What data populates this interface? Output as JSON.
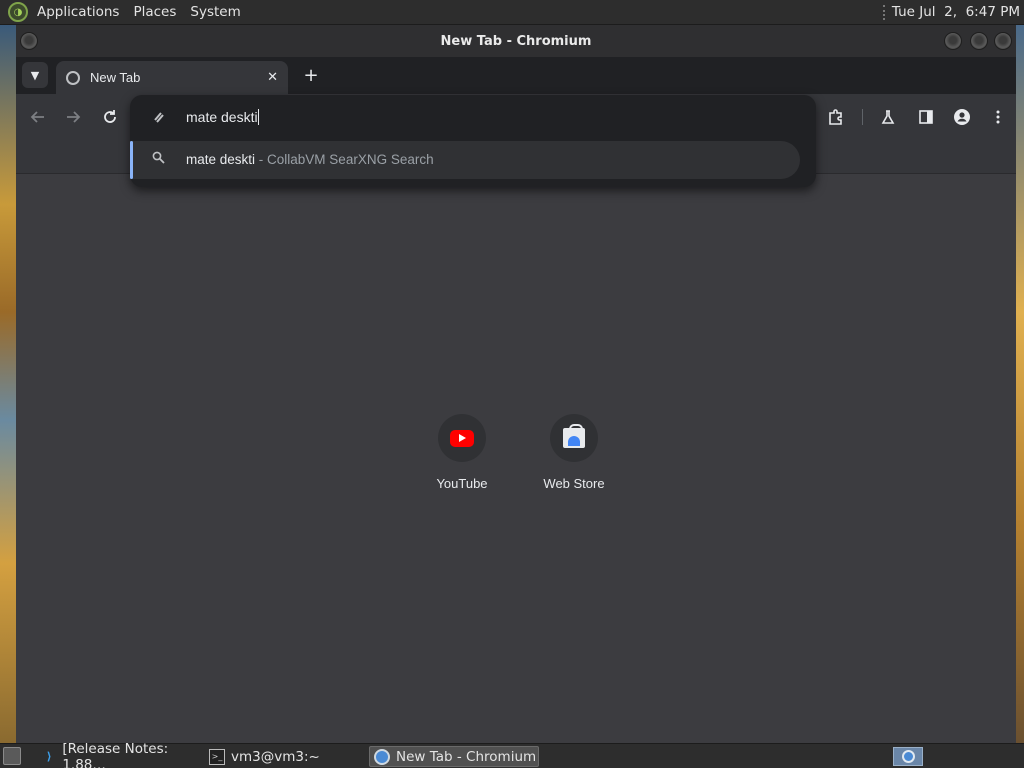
{
  "top_panel": {
    "menus": [
      "Applications",
      "Places",
      "System"
    ],
    "clock": "Tue Jul  2,  6:47 PM"
  },
  "window": {
    "title": "New Tab - Chromium"
  },
  "tab": {
    "title": "New Tab",
    "close_glyph": "✕"
  },
  "new_tab_glyph": "+",
  "omnibox": {
    "typed_text": "mate deskti",
    "suggestion": {
      "query": "mate deskti",
      "engine": " - CollabVM SearXNG Search"
    }
  },
  "shortcuts": [
    {
      "label": "YouTube",
      "icon": "youtube-icon"
    },
    {
      "label": "Web Store",
      "icon": "web-store-icon"
    }
  ],
  "taskbar": {
    "tasks": [
      {
        "label": "[Release Notes: 1.88…",
        "icon": "vscode-icon"
      },
      {
        "label": "vm3@vm3:~",
        "icon": "terminal-icon"
      },
      {
        "label": "New Tab - Chromium",
        "icon": "chromium-icon",
        "active": true
      }
    ]
  }
}
